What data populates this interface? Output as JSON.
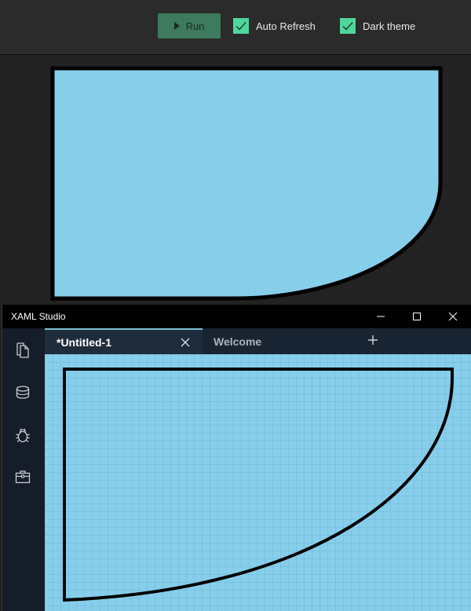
{
  "toolbar": {
    "run_label": "Run",
    "auto_refresh_label": "Auto Refresh",
    "auto_refresh_checked": true,
    "dark_theme_label": "Dark theme",
    "dark_theme_checked": true
  },
  "colors": {
    "accent_check": "#4fd69c",
    "run_button": "#3d7a5e",
    "shape_fill": "#87ceeb",
    "shape_stroke": "#000000",
    "tab_accent": "#7fc3d8"
  },
  "window": {
    "title": "XAML Studio",
    "controls": [
      "minimize-icon",
      "maximize-icon",
      "close-icon"
    ]
  },
  "sidebar": {
    "items": [
      {
        "icon": "documents-icon"
      },
      {
        "icon": "database-icon"
      },
      {
        "icon": "bug-icon"
      },
      {
        "icon": "toolbox-icon"
      }
    ]
  },
  "tabs": [
    {
      "label": "*Untitled-1",
      "active": true
    },
    {
      "label": "Welcome",
      "active": false
    }
  ]
}
